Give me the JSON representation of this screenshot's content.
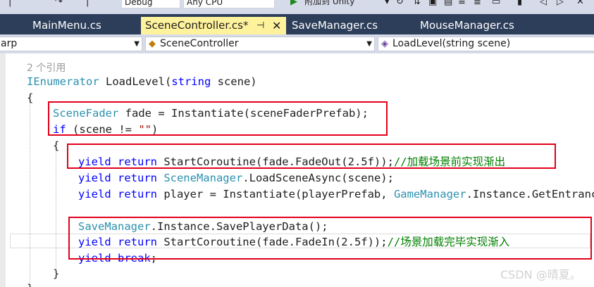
{
  "toolbar": {
    "config": "Debug",
    "platform": "Any CPU",
    "attach_label": "附加到 Unity"
  },
  "tabs": [
    {
      "label": "MainMenu.cs"
    },
    {
      "label": "SceneController.cs*",
      "pin": "⊣",
      "close": "✕"
    },
    {
      "label": "SaveManager.cs"
    },
    {
      "label": "MouseManager.cs"
    }
  ],
  "nav": {
    "project": "arp",
    "class": "SceneController",
    "member": "LoadLevel(string scene)"
  },
  "code": {
    "refs": "2 个引用",
    "signature": {
      "kw": "IEnumerator",
      "rest": " LoadLevel(",
      "kw2": "string",
      "rest2": " scene)"
    },
    "open_brace": "{",
    "l_fade": {
      "ty": "SceneFader",
      "rest": " fade = Instantiate(sceneFaderPrefab);"
    },
    "l_if": {
      "kw": "if",
      "a": " (scene != ",
      "str": "\"\"",
      "b": ")"
    },
    "inner_open": "{",
    "l_fadeout": {
      "kw": "yield return",
      "rest": " StartCoroutine(fade.FadeOut(2.5f));",
      "comment": "//加载场景前实现渐出"
    },
    "l_loadscene": {
      "kw": "yield return",
      "ty": " SceneManager",
      "rest": ".LoadSceneAsync(scene);"
    },
    "l_player": {
      "kw": "yield return",
      "a": " player = Instantiate(playerPrefab, ",
      "ty": "GameManager",
      "b": ".Instance.GetEntrance"
    },
    "l_save": {
      "ty": "SaveManager",
      "rest": ".Instance.SavePlayerData();"
    },
    "l_fadein": {
      "kw": "yield return",
      "rest": " StartCoroutine(fade.FadeIn(2.5f));",
      "comment": "//场景加载完毕实现渐入"
    },
    "l_break": {
      "kw": "yield break",
      "rest": ";"
    },
    "inner_close": "}",
    "outer_close": "}"
  },
  "watermark": "CSDN @晴夏。"
}
